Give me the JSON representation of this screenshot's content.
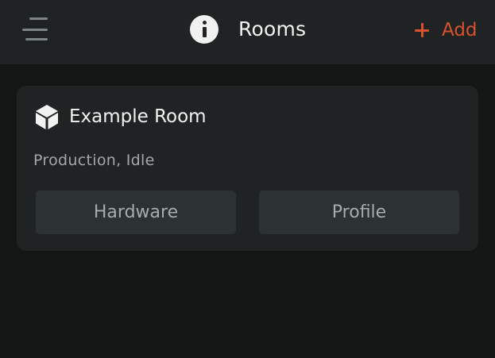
{
  "header": {
    "menu_icon": "menu-icon",
    "info_icon": "info-icon",
    "title": "Rooms",
    "add_label": "Add",
    "accent_color": "#d8522e"
  },
  "rooms": [
    {
      "icon": "cube-icon",
      "name": "Example Room",
      "status": "Production, Idle",
      "buttons": {
        "hardware": "Hardware",
        "profile": "Profile"
      }
    }
  ]
}
